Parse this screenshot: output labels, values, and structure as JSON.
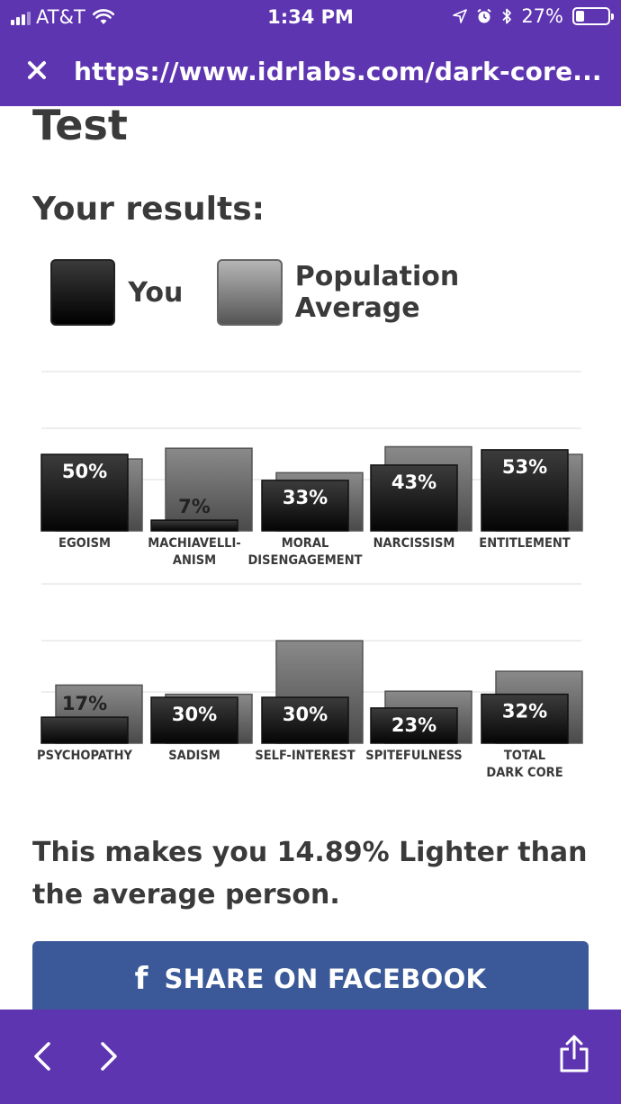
{
  "status_bar": {
    "carrier": "AT&T",
    "time": "1:34 PM",
    "battery": "27%",
    "battery_level": 0.27
  },
  "browser": {
    "url": "https://www.idrlabs.com/dark-core..."
  },
  "page": {
    "title_tail": "Test",
    "results_heading": "Your results:",
    "legend": {
      "you": "You",
      "population": "Population Average"
    },
    "summary": "This makes you 14.89% Lighter than the average person.",
    "share_button": "SHARE ON FACEBOOK",
    "share_icon": "f"
  },
  "colors": {
    "brand": "#5e35b1",
    "facebook": "#3b5998"
  },
  "chart_data": {
    "type": "bar",
    "ylim": [
      0,
      100
    ],
    "grid": true,
    "legend": "top-left",
    "series": [
      {
        "name": "You",
        "role": "you"
      },
      {
        "name": "Population Average",
        "role": "population"
      }
    ],
    "rows": [
      {
        "categories": [
          {
            "label": [
              "EGOISM"
            ],
            "you": 50,
            "you_label": "50%",
            "population": 47
          },
          {
            "label": [
              "MACHIAVELLI-",
              "ANISM"
            ],
            "you": 7,
            "you_label": "7%",
            "population": 54
          },
          {
            "label": [
              "MORAL",
              "DISENGAGEMENT"
            ],
            "you": 33,
            "you_label": "33%",
            "population": 38
          },
          {
            "label": [
              "NARCISSISM"
            ],
            "you": 43,
            "you_label": "43%",
            "population": 55
          },
          {
            "label": [
              "ENTITLEMENT"
            ],
            "you": 53,
            "you_label": "53%",
            "population": 50
          }
        ]
      },
      {
        "categories": [
          {
            "label": [
              "PSYCHOPATHY"
            ],
            "you": 17,
            "you_label": "17%",
            "population": 38
          },
          {
            "label": [
              "SADISM"
            ],
            "you": 30,
            "you_label": "30%",
            "population": 32
          },
          {
            "label": [
              "SELF-INTEREST"
            ],
            "you": 30,
            "you_label": "30%",
            "population": 67
          },
          {
            "label": [
              "SPITEFULNESS"
            ],
            "you": 23,
            "you_label": "23%",
            "population": 34
          },
          {
            "label": [
              "TOTAL",
              "DARK CORE"
            ],
            "you": 32,
            "you_label": "32%",
            "population": 47
          }
        ]
      }
    ]
  }
}
